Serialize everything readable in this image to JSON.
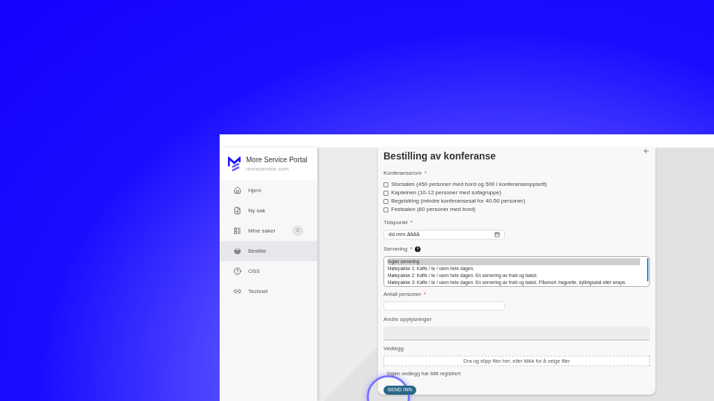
{
  "sidebar": {
    "title": "More Service Portal",
    "subtitle": "moreservice.com",
    "items": [
      {
        "label": "Hjem",
        "selected": false
      },
      {
        "label": "Ny sak",
        "selected": false
      },
      {
        "label": "Mine saker",
        "selected": false,
        "badge": "2"
      },
      {
        "label": "Bestille",
        "selected": true
      },
      {
        "label": "OSS",
        "selected": false
      },
      {
        "label": "Technet",
        "selected": false
      }
    ]
  },
  "form": {
    "title": "Bestilling av konferanse",
    "rooms": {
      "label": "Konferanserom",
      "required_mark": "*",
      "options": [
        {
          "label": "Storsalen (450 personer med bord og 500 i konferanseoppsett)",
          "checked": false
        },
        {
          "label": "Kapteinen (10-12 personer med sofagruppe)",
          "checked": false
        },
        {
          "label": "Begeistring (mindre konferansesal for 40-50 personer)",
          "checked": false
        },
        {
          "label": "Festsalen (60 personer med bord)",
          "checked": false
        }
      ]
    },
    "time": {
      "label": "Tidspunkt",
      "required_mark": "*",
      "placeholder": "dd.mm.åååå"
    },
    "serving": {
      "label": "Servering",
      "required_mark": "*",
      "options": [
        {
          "label": "Ingen servering",
          "selected": true
        },
        {
          "label": "Møtepakke 1: Kaffe / te / vann hele dagen.",
          "selected": false
        },
        {
          "label": "Møtepakke 2: Kaffe / te / vann hele dagen. En servering av frukt og bakst.",
          "selected": false
        },
        {
          "label": "Møtepakke 3: Kaffe / te / vann hele dagen. En servering av frukt og bakst. Påsmurt: baguette, kyllingsalat eller wraps.",
          "selected": false
        }
      ]
    },
    "persons": {
      "label": "Antall personer",
      "required_mark": "*"
    },
    "other": {
      "label": "Andre opplysninger"
    },
    "attachments": {
      "label": "Vedlegg",
      "dropzone": "Dra og slipp filer her, eller klikk for å velge filer",
      "status": "Ingen vedlegg har blitt registrert"
    },
    "submit": "SEND INN"
  }
}
